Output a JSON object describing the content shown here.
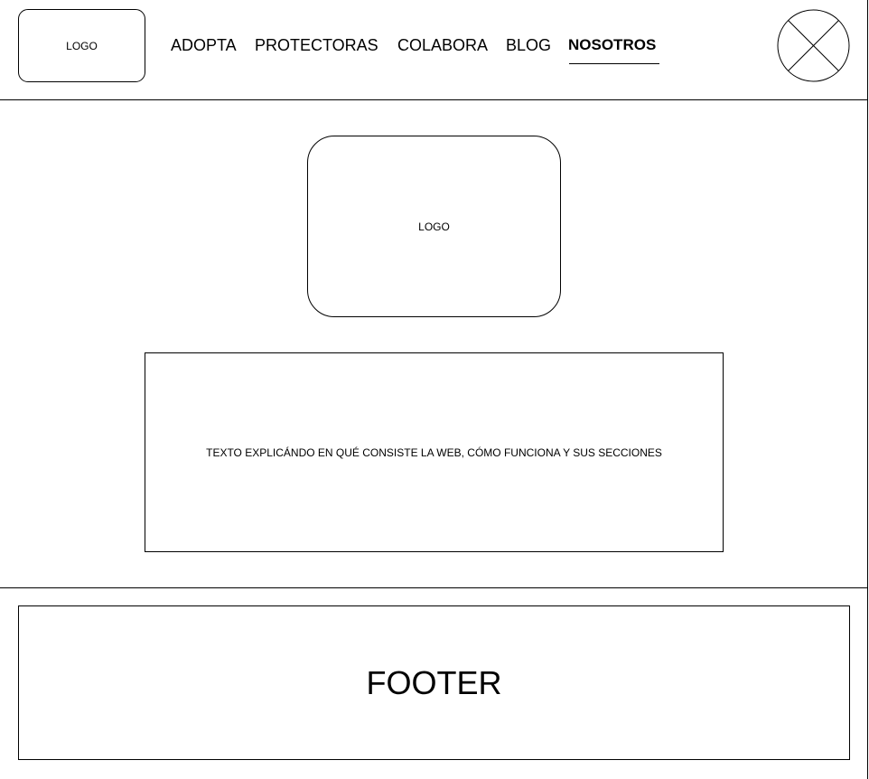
{
  "header": {
    "logo_text": "LOGO",
    "nav": {
      "items": [
        "ADOPTA",
        "PROTECTORAS",
        "COLABORA",
        "BLOG",
        "NOSOTROS"
      ],
      "active": "NOSOTROS"
    },
    "close_icon": "close-circle-icon"
  },
  "main": {
    "logo_text": "LOGO",
    "description": "TEXTO EXPLICÁNDO EN QUÉ CONSISTE LA WEB, CÓMO FUNCIONA Y SUS SECCIONES"
  },
  "footer": {
    "label": "FOOTER"
  },
  "colors": {
    "line": "#000000",
    "background": "#ffffff"
  }
}
